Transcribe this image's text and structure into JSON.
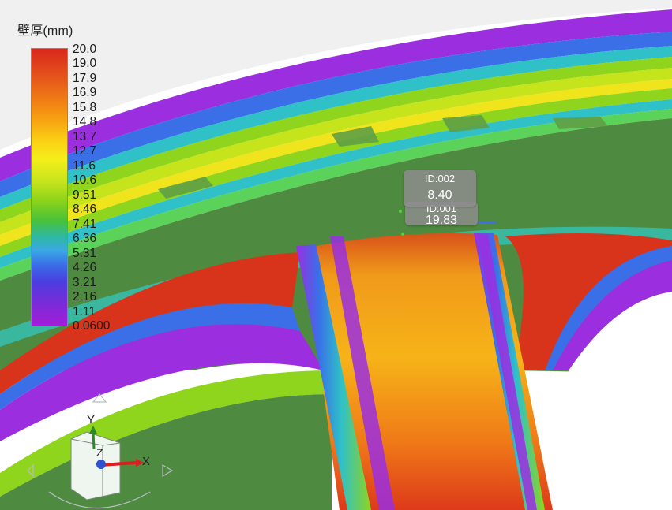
{
  "legend": {
    "title": "壁厚(mm)",
    "ticks": [
      "20.0",
      "19.0",
      "17.9",
      "16.9",
      "15.8",
      "14.8",
      "13.7",
      "12.7",
      "11.6",
      "10.6",
      "9.51",
      "8.46",
      "7.41",
      "6.36",
      "5.31",
      "4.26",
      "3.21",
      "2.16",
      "1.11",
      "0.0600"
    ]
  },
  "probes": [
    {
      "id": "ID:002",
      "value": "8.40"
    },
    {
      "id": "ID:001",
      "value": "19.83"
    }
  ],
  "triad": {
    "x": "X",
    "y": "Y",
    "z": "Z"
  },
  "colors": {
    "purple": "#9b2fe0",
    "green": "#4e8a3f",
    "yellow": "#e6e11c",
    "orange": "#f0901a",
    "red": "#d8341c",
    "blue": "#3a6fe8",
    "cyan": "#2fc0c8"
  }
}
